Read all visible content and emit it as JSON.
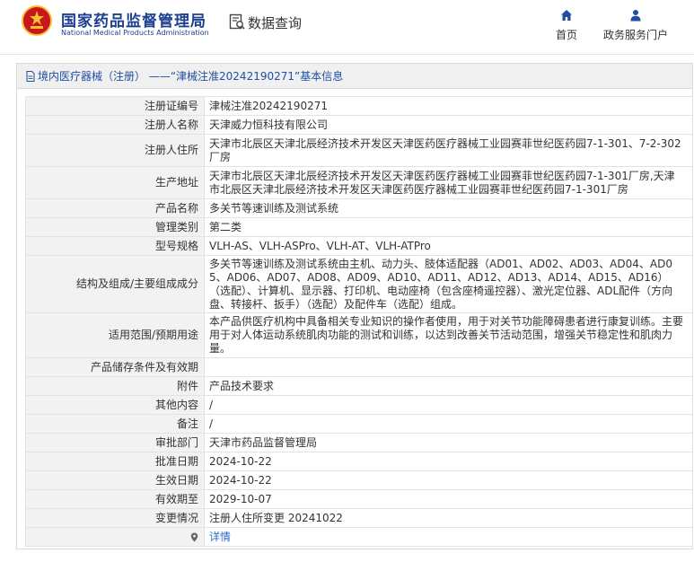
{
  "header": {
    "logo_cn": "国家药品监督管理局",
    "logo_en": "National Medical Products Administration",
    "data_query": "数据查询",
    "nav": {
      "home": "首页",
      "portal": "政务服务门户"
    }
  },
  "breadcrumb": {
    "text": "境内医疗器械（注册） ——“津械注准20242190271”基本信息"
  },
  "rows": [
    {
      "label": "注册证编号",
      "value": "津械注准20242190271"
    },
    {
      "label": "注册人名称",
      "value": "天津威力恒科技有限公司"
    },
    {
      "label": "注册人住所",
      "value": "天津市北辰区天津北辰经济技术开发区天津医药医疗器械工业园赛菲世纪医药园7-1-301、7-2-302厂房"
    },
    {
      "label": "生产地址",
      "value": "天津市北辰区天津北辰经济技术开发区天津医药医疗器械工业园赛菲世纪医药园7-1-301厂房,天津市北辰区天津北辰经济技术开发区天津医药医疗器械工业园赛菲世纪医药园7-1-301厂房"
    },
    {
      "label": "产品名称",
      "value": "多关节等速训练及测试系统"
    },
    {
      "label": "管理类别",
      "value": "第二类"
    },
    {
      "label": "型号规格",
      "value": "VLH-AS、VLH-ASPro、VLH-AT、VLH-ATPro"
    },
    {
      "label": "结构及组成/主要组成成分",
      "value": "多关节等速训练及测试系统由主机、动力头、肢体适配器（AD01、AD02、AD03、AD04、AD05、AD06、AD07、AD08、AD09、AD10、AD11、AD12、AD13、AD14、AD15、AD16）（选配）、计算机、显示器、打印机、电动座椅（包含座椅遥控器）、激光定位器、ADL配件（方向盘、转接杆、扳手）（选配）及配件车（选配）组成。"
    },
    {
      "label": "适用范围/预期用途",
      "value": "本产品供医疗机构中具备相关专业知识的操作者使用，用于对关节功能障碍患者进行康复训练。主要用于对人体运动系统肌肉功能的测试和训练，以达到改善关节活动范围，增强关节稳定性和肌肉力量。"
    },
    {
      "label": "产品储存条件及有效期",
      "value": ""
    },
    {
      "label": "附件",
      "value": "产品技术要求"
    },
    {
      "label": "其他内容",
      "value": "/"
    },
    {
      "label": "备注",
      "value": "/"
    },
    {
      "label": "审批部门",
      "value": "天津市药品监督管理局"
    },
    {
      "label": "批准日期",
      "value": "2024-10-22"
    },
    {
      "label": "生效日期",
      "value": "2024-10-22"
    },
    {
      "label": "有效期至",
      "value": "2029-10-07"
    },
    {
      "label": "变更情况",
      "value": "注册人住所变更 20241022"
    }
  ],
  "detail_link": "详情",
  "colors": {
    "brand": "#1d3f8f",
    "link": "#2b6cc4",
    "label_bg": "#f2f2f2",
    "emblem_red": "#c8161d",
    "emblem_gold": "#f2c230"
  }
}
